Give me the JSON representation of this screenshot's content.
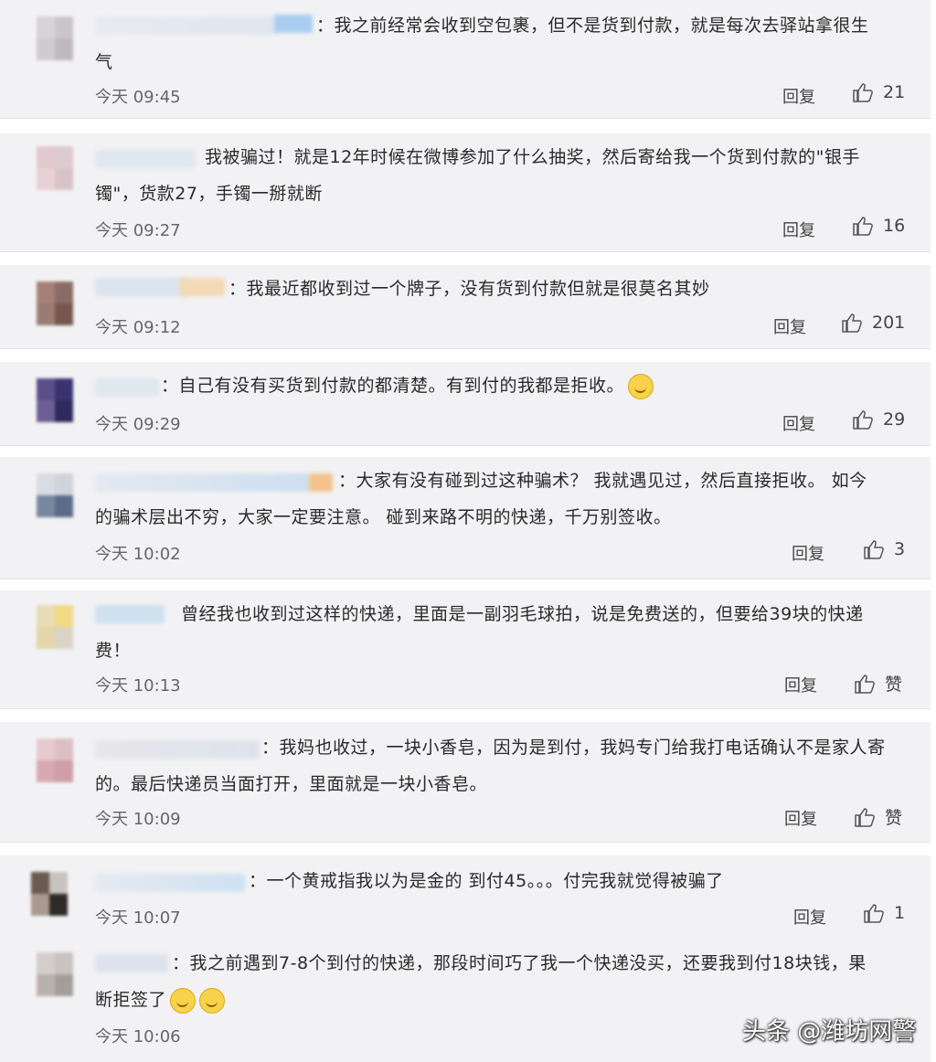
{
  "comments": [
    {
      "text_line1": "：我之前经常会收到空包裹，但不是货到付款，就是每次去驿站拿很生",
      "text_line2": "气",
      "time": "今天 09:45",
      "reply": "回复",
      "likes": "21"
    },
    {
      "text_line1": "我被骗过！就是12年时候在微博参加了什么抽奖，然后寄给我一个货到付款的\"银手",
      "text_line2": "镯\"，货款27，手镯一掰就断",
      "time": "今天 09:27",
      "reply": "回复",
      "likes": "16"
    },
    {
      "text_line1": "：我最近都收到过一个牌子，没有货到付款但就是很莫名其妙",
      "text_line2": "",
      "time": "今天 09:12",
      "reply": "回复",
      "likes": "201"
    },
    {
      "text_line1": "：自己有没有买货到付款的都清楚。有到付的我都是拒收。",
      "text_line2": "",
      "time": "今天 09:29",
      "reply": "回复",
      "likes": "29"
    },
    {
      "text_line1": "：大家有没有碰到过这种骗术？ 我就遇见过，然后直接拒收。 如今",
      "text_line2": "的骗术层出不穷，大家一定要注意。 碰到来路不明的快递，千万别签收。",
      "time": "今天 10:02",
      "reply": "回复",
      "likes": "3"
    },
    {
      "text_line1": "曾经我也收到过这样的快递，里面是一副羽毛球拍，说是免费送的，但要给39块的快递",
      "text_line2": "费！",
      "time": "今天 10:13",
      "reply": "回复",
      "likes": "赞"
    },
    {
      "text_line1": "：我妈也收过，一块小香皂，因为是到付，我妈专门给我打电话确认不是家人寄",
      "text_line2": "的。最后快递员当面打开，里面就是一块小香皂。",
      "time": "今天 10:09",
      "reply": "回复",
      "likes": "赞"
    },
    {
      "text_line1": "：一个黄戒指我以为是金的 到付45。。。付完我就觉得被骗了",
      "text_line2": "",
      "time": "今天 10:07",
      "reply": "回复",
      "likes": "1"
    },
    {
      "text_line1": "：我之前遇到7-8个到付的快递，那段时间巧了我一个快递没买，还要我到付18块钱，果",
      "text_line2": "断拒签了",
      "time": "今天 10:06",
      "reply": "",
      "likes": ""
    }
  ],
  "watermark": "头条 @潍坊网警"
}
